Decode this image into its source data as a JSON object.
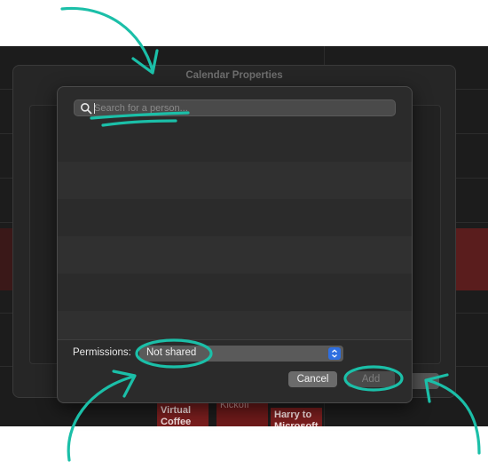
{
  "window": {
    "title": "Calendar Properties"
  },
  "search": {
    "placeholder": "Search for a person..."
  },
  "permissions": {
    "label": "Permissions:",
    "value": "Not shared"
  },
  "buttons": {
    "cancel": "Cancel",
    "add": "Add"
  },
  "calendar_events": [
    {
      "text": "Virtual\nCoffee"
    },
    {
      "text": "Kickoff"
    },
    {
      "text": "Harry to\nMicrosoft"
    }
  ],
  "colors": {
    "annotation": "#1bbfa8",
    "accent": "#2f6fe0",
    "event": "#7a1e1e"
  }
}
